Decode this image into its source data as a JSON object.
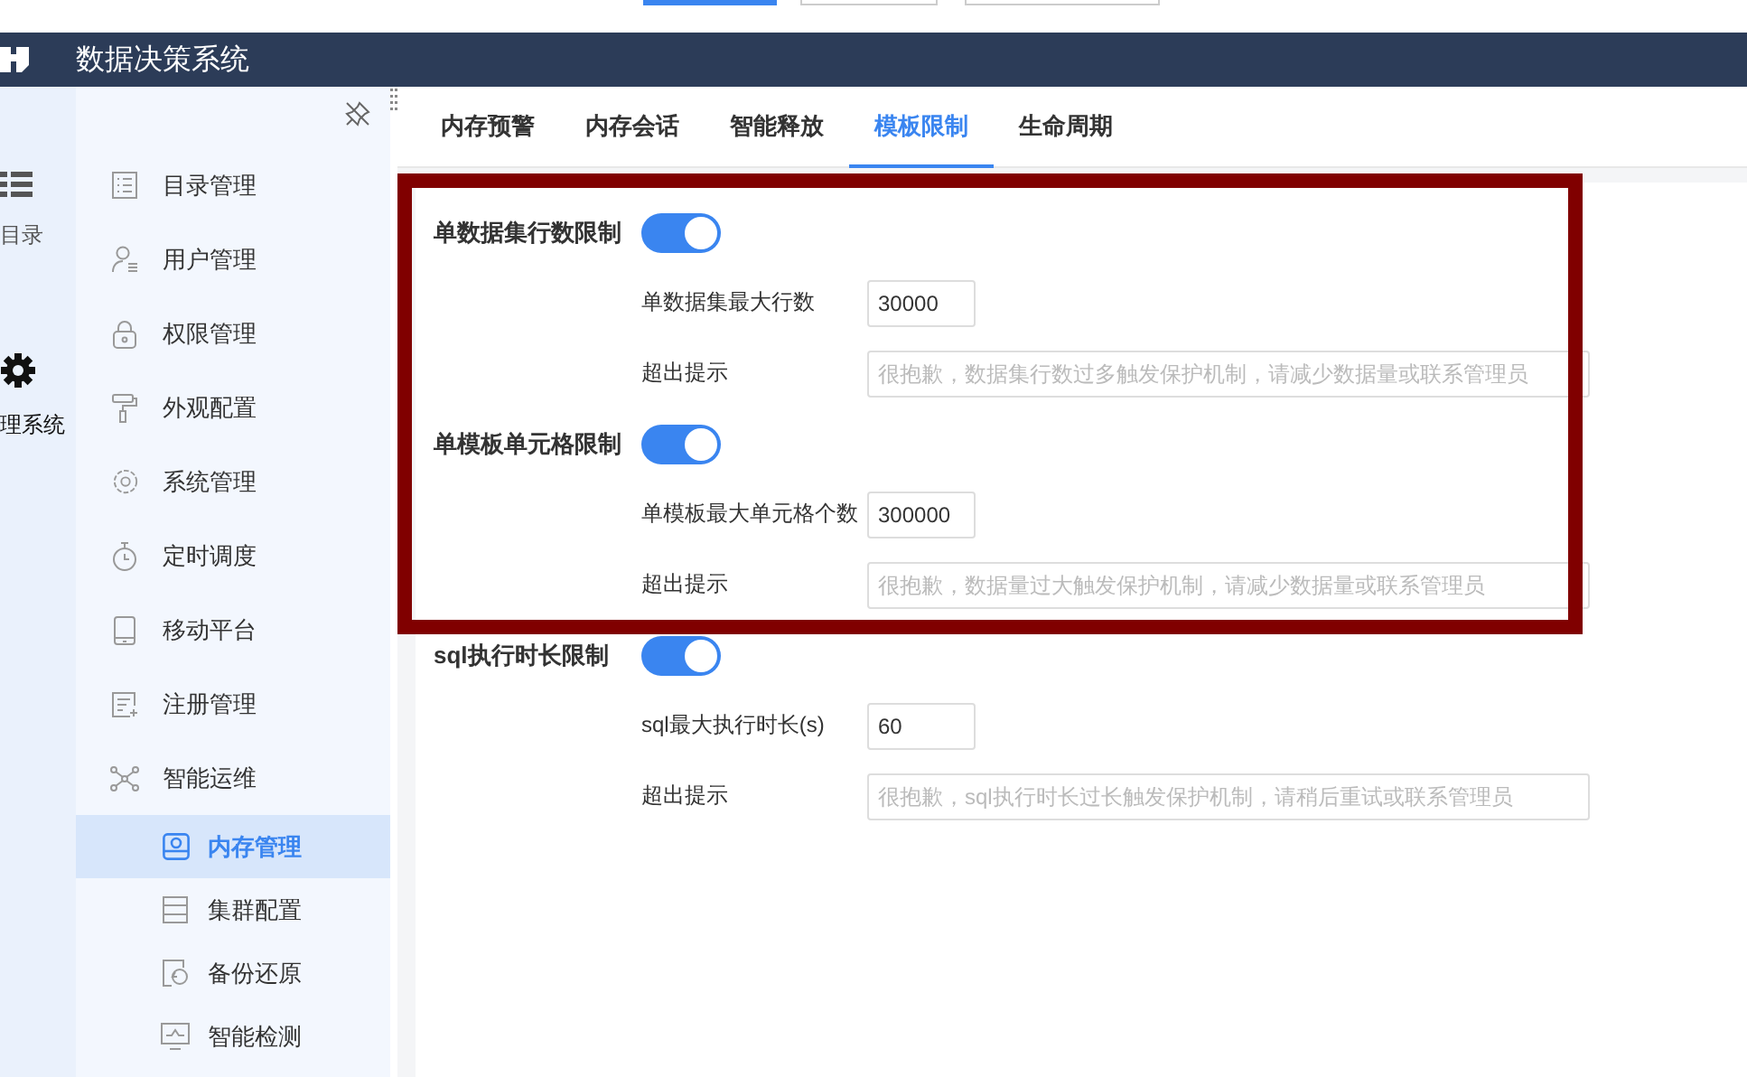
{
  "header": {
    "title": "数据决策系统"
  },
  "rail": [
    {
      "label": "目录"
    },
    {
      "label": "理系统"
    }
  ],
  "menu": [
    {
      "label": "目录管理",
      "selected": false
    },
    {
      "label": "用户管理",
      "selected": false
    },
    {
      "label": "权限管理",
      "selected": false
    },
    {
      "label": "外观配置",
      "selected": false
    },
    {
      "label": "系统管理",
      "selected": false
    },
    {
      "label": "定时调度",
      "selected": false
    },
    {
      "label": "移动平台",
      "selected": false
    },
    {
      "label": "注册管理",
      "selected": false
    },
    {
      "label": "智能运维",
      "selected": false,
      "expanded": true,
      "children": [
        {
          "label": "内存管理",
          "selected": true
        },
        {
          "label": "集群配置",
          "selected": false
        },
        {
          "label": "备份还原",
          "selected": false
        },
        {
          "label": "智能检测",
          "selected": false
        }
      ]
    }
  ],
  "tabs": [
    {
      "label": "内存预警",
      "selected": false
    },
    {
      "label": "内存会话",
      "selected": false
    },
    {
      "label": "智能释放",
      "selected": false
    },
    {
      "label": "模板限制",
      "selected": true
    },
    {
      "label": "生命周期",
      "selected": false
    }
  ],
  "limits": [
    {
      "label": "单数据集行数限制",
      "on": true,
      "max_label": "单数据集最大行数",
      "max_value": "30000",
      "hint_label": "超出提示",
      "hint_placeholder": "很抱歉，数据集行数过多触发保护机制，请减少数据量或联系管理员"
    },
    {
      "label": "单模板单元格限制",
      "on": true,
      "max_label": "单模板最大单元格个数",
      "max_value": "300000",
      "hint_label": "超出提示",
      "hint_placeholder": "很抱歉，数据量过大触发保护机制，请减少数据量或联系管理员"
    },
    {
      "label": "sql执行时长限制",
      "on": true,
      "max_label": "sql最大执行时长(s)",
      "max_value": "60",
      "hint_label": "超出提示",
      "hint_placeholder": "很抱歉，sql执行时长过长触发保护机制，请稍后重试或联系管理员"
    }
  ]
}
